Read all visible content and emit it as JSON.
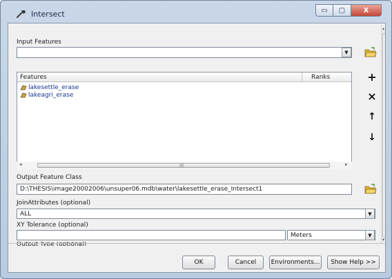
{
  "window": {
    "title": "Intersect",
    "minimize": "▭",
    "maximize": "▢",
    "close": "X"
  },
  "input_features": {
    "label": "Input Features",
    "value": "",
    "table": {
      "col_features": "Features",
      "col_ranks": "Ranks",
      "rows": [
        "lakesettle_erase",
        "lakeagri_erase"
      ]
    },
    "scroll_thumb_grip": "III"
  },
  "side_buttons": {
    "add": "+",
    "remove": "×",
    "up": "↑",
    "down": "↓"
  },
  "output_feature_class": {
    "label": "Output Feature Class",
    "value": "D:\\THESIS\\image20002006\\unsuper06.mdb\\water\\lakesettle_erase_Intersect1"
  },
  "join_attributes": {
    "label": "JoinAttributes (optional)",
    "value": "ALL"
  },
  "xy_tolerance": {
    "label": "XY Tolerance (optional)",
    "value": "",
    "unit": "Meters"
  },
  "output_type": {
    "label": "Output Type (optional)"
  },
  "buttons": {
    "ok": "OK",
    "cancel": "Cancel",
    "environments": "Environments...",
    "show_help": "Show Help >>"
  },
  "colors": {
    "accent": "#16368c",
    "close": "#c4463a",
    "folder": "#e0b13a"
  }
}
